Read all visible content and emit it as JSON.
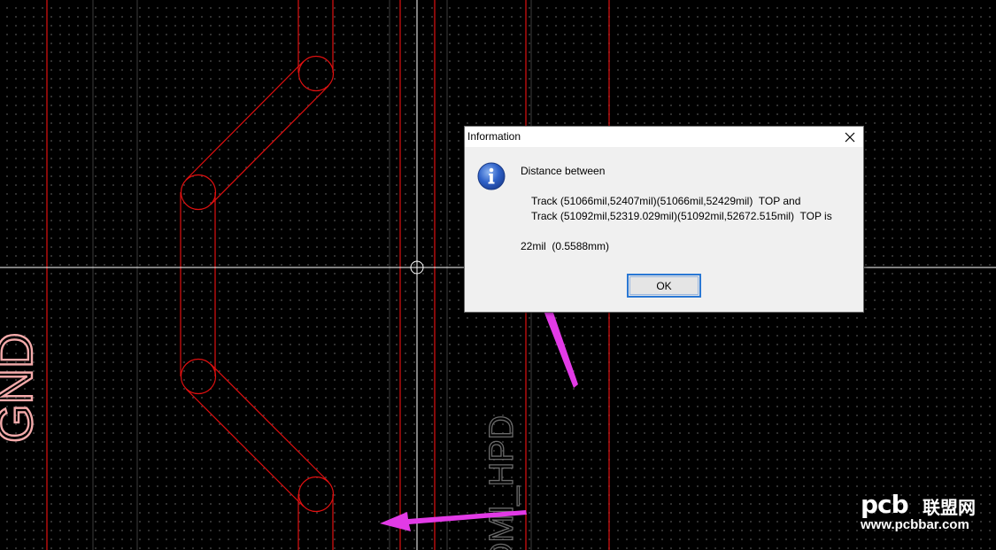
{
  "pcb": {
    "net_labels": {
      "gnd": "GND",
      "hpd": "DMI_HPD"
    },
    "colors": {
      "background": "#000000",
      "grid_dot": "#3a3a3a",
      "track_outline": "#e01010",
      "gnd_text": "#f4aaaa",
      "hpd_text": "#606060",
      "crosshair": "#ffffff",
      "arrow": "#e23ae6"
    }
  },
  "dialog": {
    "title": "Information",
    "icon": "info-icon",
    "close_icon": "close-icon",
    "heading": "Distance between",
    "track1": "Track (51066mil,52407mil)(51066mil,52429mil)  TOP and",
    "track2": "Track (51092mil,52319.029mil)(51092mil,52672.515mil)  TOP is",
    "result": "22mil  (0.5588mm)",
    "ok_label": "OK"
  },
  "watermark": {
    "logo": "pcb",
    "cn_text": "联盟网",
    "url": "www.pcbbar.com"
  }
}
